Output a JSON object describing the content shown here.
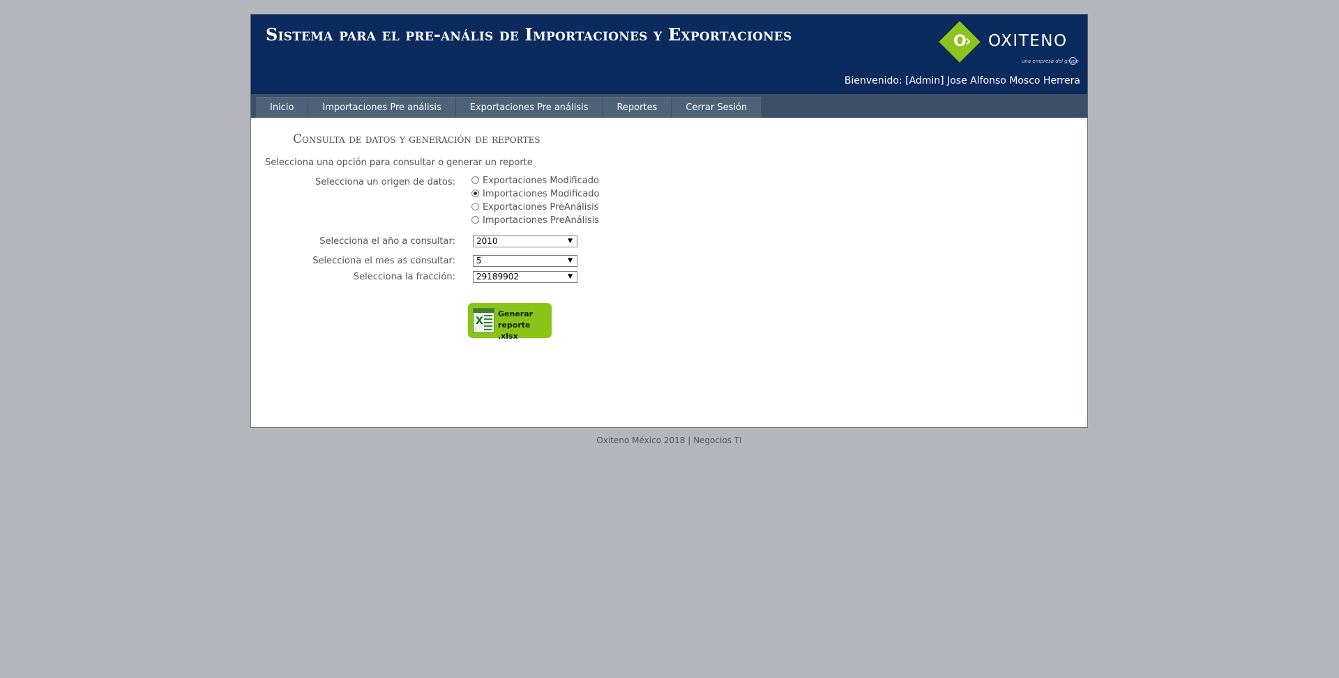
{
  "header": {
    "title": "Sistema para el pre-anális de Importaciones y Exportaciones",
    "logo": {
      "brand": "OXITENO",
      "tagline": "una empresa del grupo",
      "color": "#8dc21f"
    },
    "welcome": "Bienvenido: [Admin] Jose Alfonso Mosco Herrera"
  },
  "nav": {
    "items": [
      {
        "label": "Inicio"
      },
      {
        "label": "Importaciones Pre análisis"
      },
      {
        "label": "Exportaciones Pre análisis"
      },
      {
        "label": "Reportes"
      },
      {
        "label": "Cerrar Sesión"
      }
    ]
  },
  "main": {
    "section_title": "Consulta de datos y generación de reportes",
    "instructions": "Selecciona una opción para consultar o generar un reporte",
    "origin": {
      "label": "Selecciona un origen de datos:",
      "options": [
        {
          "label": "Exportaciones Modificado",
          "checked": false
        },
        {
          "label": "Importaciones Modificado",
          "checked": true
        },
        {
          "label": "Exportaciones PreAnálisis",
          "checked": false
        },
        {
          "label": "Importaciones PreAnálisis",
          "checked": false
        }
      ]
    },
    "year": {
      "label": "Selecciona el año a consultar:",
      "value": "2010"
    },
    "month": {
      "label": "Selecciona el mes as consultar:",
      "value": "5"
    },
    "fraction": {
      "label": "Selecciona la fracción:",
      "value": "29189902"
    },
    "generate_button": {
      "label": "Generar reporte .xlsx",
      "icon": "excel-icon",
      "color": "#87c416"
    }
  },
  "footer": {
    "text": "Oxiteno México 2018 | Negocios TI"
  }
}
